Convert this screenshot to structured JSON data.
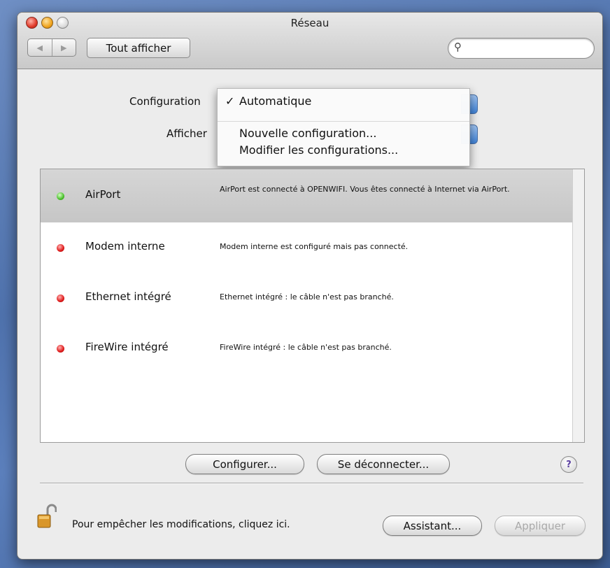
{
  "window": {
    "title": "Réseau"
  },
  "toolbar": {
    "show_all_label": "Tout afficher",
    "search_value": "",
    "search_placeholder": ""
  },
  "config": {
    "label": "Configuration",
    "afficher_label": "Afficher",
    "menu": {
      "checked_index": 0,
      "items": [
        "Automatique",
        "Nouvelle configuration...",
        "Modifier les configurations..."
      ],
      "check_glyph": "✓"
    }
  },
  "services": [
    {
      "name": "AirPort",
      "status": "green",
      "selected": true,
      "desc": "AirPort est connecté à OPENWIFI. Vous êtes connecté à Internet via AirPort."
    },
    {
      "name": "Modem interne",
      "status": "red",
      "selected": false,
      "desc": "Modem interne est configuré mais pas connecté."
    },
    {
      "name": "Ethernet intégré",
      "status": "red",
      "selected": false,
      "desc": "Ethernet intégré : le câble n'est pas branché."
    },
    {
      "name": "FireWire intégré",
      "status": "red",
      "selected": false,
      "desc": "FireWire intégré : le câble n'est pas branché."
    }
  ],
  "actions": {
    "configure": "Configurer...",
    "disconnect": "Se déconnecter...",
    "help": "?"
  },
  "footer": {
    "lock_text": "Pour empêcher les modifications, cliquez ici.",
    "assistant": "Assistant...",
    "apply": "Appliquer"
  },
  "colors": {
    "status_green": "#49c02b",
    "status_red": "#df1a1a",
    "selection": "#cfcfcf"
  },
  "icons": {
    "close": "close-icon",
    "minimize": "minimize-icon",
    "zoom": "zoom-icon",
    "back": "back-arrow-icon",
    "forward": "forward-arrow-icon",
    "search": "search-icon",
    "lock": "lock-icon",
    "help": "help-icon"
  }
}
